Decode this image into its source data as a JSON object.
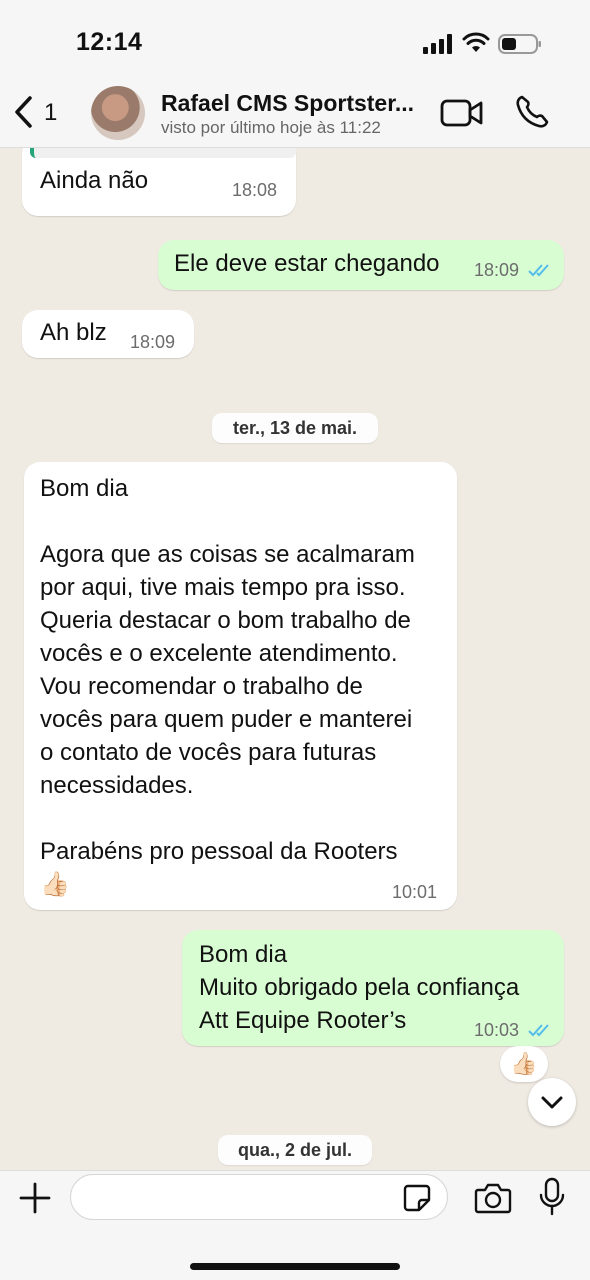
{
  "status_bar": {
    "time": "12:14"
  },
  "header": {
    "back_count": "1",
    "contact_name": "Rafael CMS Sportster...",
    "contact_status": "visto por último hoje às 11:22"
  },
  "messages": [
    {
      "direction": "in",
      "text": "Ainda não",
      "time": "18:08"
    },
    {
      "direction": "out",
      "text": "Ele deve estar chegando",
      "time": "18:09",
      "read": true
    },
    {
      "direction": "in",
      "text": "Ah blz",
      "time": "18:09"
    },
    {
      "direction": "in",
      "text": "Bom dia\n\nAgora que as coisas se acalmaram\npor aqui, tive mais tempo pra isso.\nQueria destacar o bom trabalho de\nvocês e o excelente atendimento.\nVou recomendar o trabalho de\nvocês para quem puder e manterei\no contato de vocês para futuras\nnecessidades.\n\nParabéns pro pessoal da Rooters\n👍🏻",
      "time": "10:01"
    },
    {
      "direction": "out",
      "text": "Bom dia\nMuito obrigado pela confiança\nAtt Equipe Rooter’s",
      "time": "10:03",
      "read": true,
      "reaction": "👍🏻"
    }
  ],
  "date_separators": [
    "ter., 13 de mai.",
    "qua., 2 de jul."
  ],
  "input": {
    "value": "",
    "placeholder": ""
  },
  "colors": {
    "incoming": "#ffffff",
    "outgoing": "#d9fdd3",
    "read_ticks": "#53bdeb",
    "chat_bg": "#efeae2"
  },
  "icons": [
    "back-chevron-icon",
    "video-call-icon",
    "phone-icon",
    "plus-icon",
    "sticker-icon",
    "camera-icon",
    "microphone-icon",
    "chevron-down-icon",
    "double-check-icon"
  ]
}
